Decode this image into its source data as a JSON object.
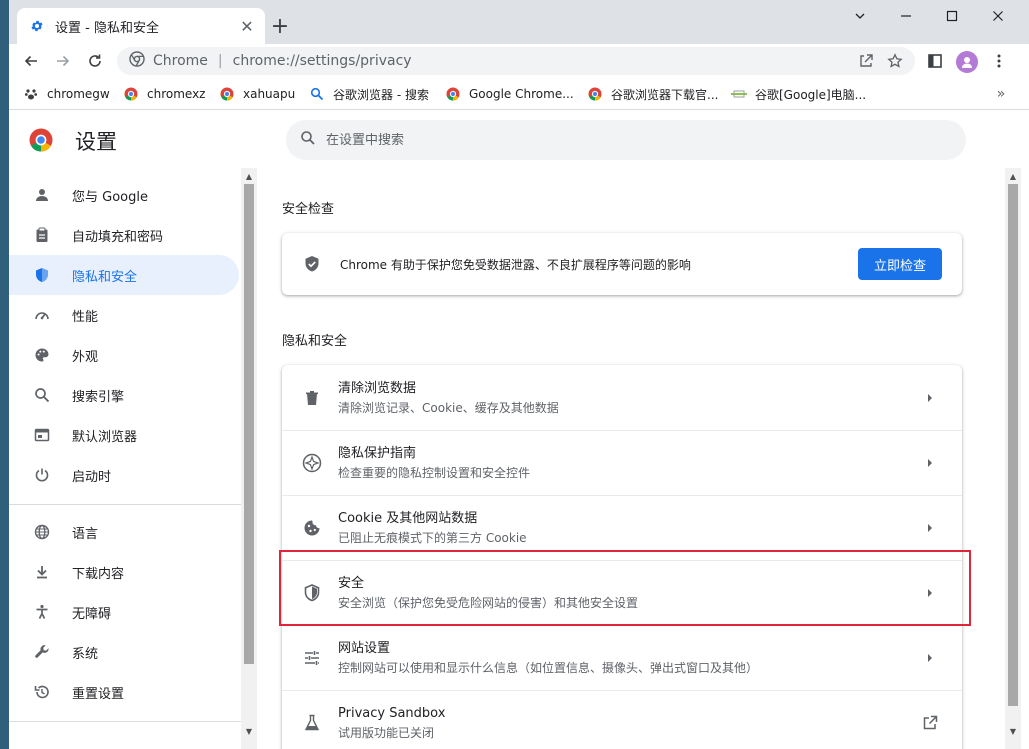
{
  "tab": {
    "title": "设置 - 隐私和安全",
    "close_icon": "close-icon"
  },
  "window": {
    "new_tab": "+"
  },
  "toolbar": {
    "site": "Chrome",
    "url": "chrome://settings/privacy"
  },
  "bookmarks": [
    {
      "label": "chromegw",
      "icon": "paw-icon"
    },
    {
      "label": "chromexz",
      "icon": "chrome-icon"
    },
    {
      "label": "xahuapu",
      "icon": "chrome-icon"
    },
    {
      "label": "谷歌浏览器 - 搜索",
      "icon": "search-icon"
    },
    {
      "label": "Google Chrome...",
      "icon": "chrome-icon"
    },
    {
      "label": "谷歌浏览器下载官...",
      "icon": "chrome-icon"
    },
    {
      "label": "谷歌[Google]电脑...",
      "icon": "bar-icon"
    }
  ],
  "bookmarks_more": "»",
  "header": {
    "title": "设置",
    "search_placeholder": "在设置中搜索"
  },
  "sidebar": {
    "items": [
      {
        "label": "您与 Google",
        "icon": "person-icon"
      },
      {
        "label": "自动填充和密码",
        "icon": "clipboard-icon"
      },
      {
        "label": "隐私和安全",
        "icon": "shield-icon",
        "active": true
      },
      {
        "label": "性能",
        "icon": "gauge-icon"
      },
      {
        "label": "外观",
        "icon": "palette-icon"
      },
      {
        "label": "搜索引擎",
        "icon": "search-icon"
      },
      {
        "label": "默认浏览器",
        "icon": "browser-icon"
      },
      {
        "label": "启动时",
        "icon": "power-icon"
      },
      {
        "label": "语言",
        "icon": "globe-icon"
      },
      {
        "label": "下载内容",
        "icon": "download-icon"
      },
      {
        "label": "无障碍",
        "icon": "accessibility-icon"
      },
      {
        "label": "系统",
        "icon": "wrench-icon"
      },
      {
        "label": "重置设置",
        "icon": "reset-icon"
      }
    ]
  },
  "safety_check": {
    "title": "安全检查",
    "text": "Chrome 有助于保护您免受数据泄露、不良扩展程序等问题的影响",
    "button": "立即检查"
  },
  "privacy": {
    "title": "隐私和安全",
    "rows": [
      {
        "title": "清除浏览数据",
        "sub": "清除浏览记录、Cookie、缓存及其他数据",
        "icon": "trash-icon"
      },
      {
        "title": "隐私保护指南",
        "sub": "检查重要的隐私控制设置和安全控件",
        "icon": "compass-icon"
      },
      {
        "title": "Cookie 及其他网站数据",
        "sub": "已阻止无痕模式下的第三方 Cookie",
        "icon": "cookie-icon"
      },
      {
        "title": "安全",
        "sub": "安全浏览（保护您免受危险网站的侵害）和其他安全设置",
        "icon": "security-shield-icon"
      },
      {
        "title": "网站设置",
        "sub": "控制网站可以使用和显示什么信息（如位置信息、摄像头、弹出式窗口及其他）",
        "icon": "sliders-icon"
      },
      {
        "title": "Privacy Sandbox",
        "sub": "试用版功能已关闭",
        "icon": "flask-icon"
      }
    ]
  },
  "colors": {
    "accent": "#1a73e8",
    "highlight": "#e0263b"
  }
}
